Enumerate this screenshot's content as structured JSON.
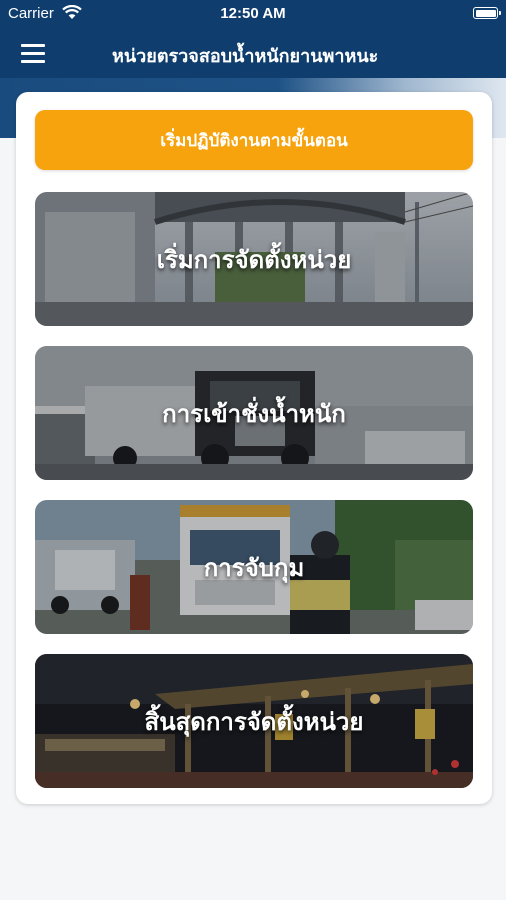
{
  "status_bar": {
    "carrier": "Carrier",
    "time": "12:50 AM",
    "wifi_icon": "wifi-icon",
    "battery_icon": "battery-full-icon"
  },
  "nav": {
    "menu_icon": "hamburger-menu-icon",
    "title": "หน่วยตรวจสอบน้ำหนักยานพาหนะ"
  },
  "main": {
    "start_button_label": "เริ่มปฏิบัติงานตามขั้นตอน",
    "tiles": [
      {
        "label": "เริ่มการจัดตั้งหน่วย",
        "photo": "weigh-station-canopy"
      },
      {
        "label": "การเข้าชั่งน้ำหนัก",
        "photo": "truck-on-scale"
      },
      {
        "label": "การจับกุม",
        "photo": "police-stopping-truck"
      },
      {
        "label": "สิ้นสุดการจัดตั้งหน่วย",
        "photo": "weigh-station-at-night"
      }
    ]
  },
  "colors": {
    "navbar": "#0f3e6e",
    "accent": "#f6a30e",
    "background": "#f5f6f8",
    "card": "#ffffff"
  }
}
